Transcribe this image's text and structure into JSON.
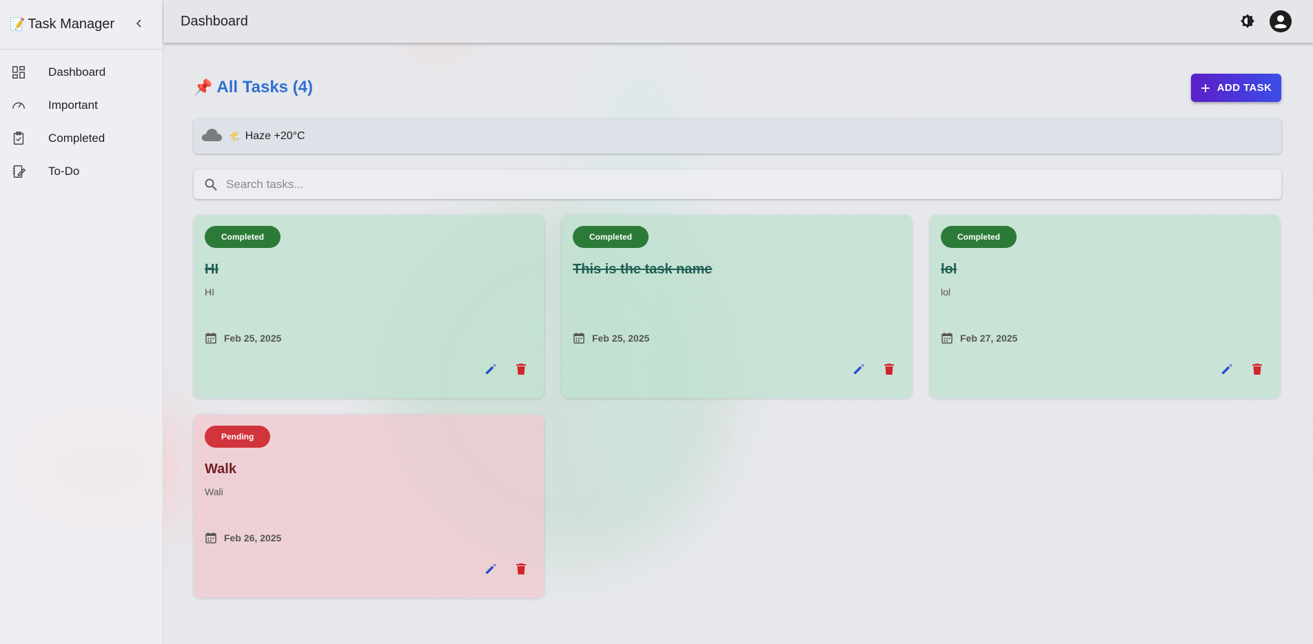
{
  "app": {
    "title": "Task Manager",
    "logo_emoji": "📝"
  },
  "sidebar": {
    "items": [
      {
        "label": "Dashboard",
        "icon": "dashboard-icon"
      },
      {
        "label": "Important",
        "icon": "speedometer-icon"
      },
      {
        "label": "Completed",
        "icon": "clipboard-check-icon"
      },
      {
        "label": "To-Do",
        "icon": "edit-note-icon"
      }
    ]
  },
  "topbar": {
    "title": "Dashboard",
    "icons": [
      "brightness-icon",
      "account-icon"
    ]
  },
  "main": {
    "heading": "All Tasks (4)",
    "heading_emoji": "📌",
    "add_button": "ADD TASK",
    "weather": {
      "emoji": "🌤️",
      "text": "Haze +20°C"
    },
    "search_placeholder": "Search tasks..."
  },
  "tasks": [
    {
      "status": "Completed",
      "title": "HI",
      "description": "HI",
      "date": "Feb 25, 2025"
    },
    {
      "status": "Completed",
      "title": "This is the task name",
      "description": "",
      "date": "Feb 25, 2025"
    },
    {
      "status": "Completed",
      "title": "lol",
      "description": "lol",
      "date": "Feb 27, 2025"
    },
    {
      "status": "Pending",
      "title": "Walk",
      "description": "Wali",
      "date": "Feb 26, 2025"
    }
  ],
  "colors": {
    "accent": "#2f6fd1",
    "completed_badge": "#2c7a37",
    "pending_badge": "#d1343a",
    "edit_icon": "#2950c9",
    "delete_icon": "#d1252b"
  }
}
